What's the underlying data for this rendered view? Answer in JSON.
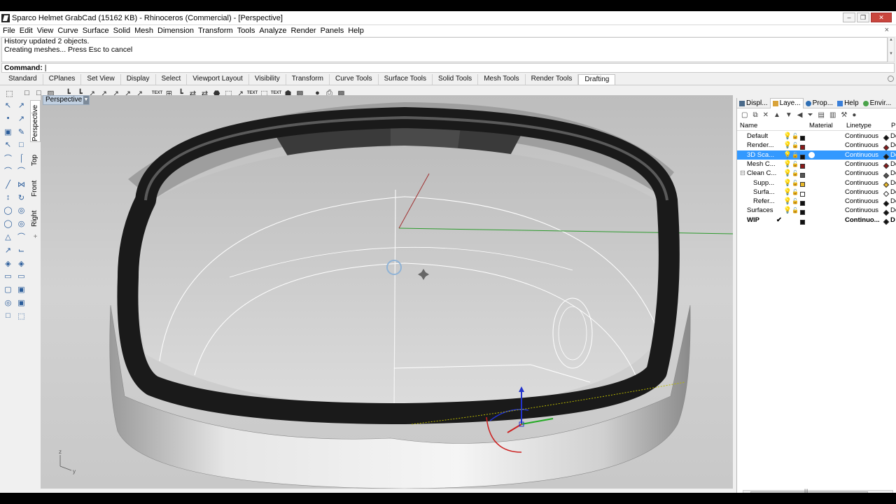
{
  "window": {
    "title": "Sparco Helmet GrabCad (15162 KB) - Rhinoceros (Commercial) - [Perspective]",
    "buttons": [
      "–",
      "❐",
      "✕"
    ]
  },
  "menu": {
    "items": [
      "File",
      "Edit",
      "View",
      "Curve",
      "Surface",
      "Solid",
      "Mesh",
      "Dimension",
      "Transform",
      "Tools",
      "Analyze",
      "Render",
      "Panels",
      "Help"
    ],
    "close": "×"
  },
  "command": {
    "history": [
      "History updated 2 objects.",
      "Creating meshes... Press Esc to cancel"
    ],
    "prompt": "Command:"
  },
  "tabs": {
    "items": [
      "Standard",
      "CPlanes",
      "Set View",
      "Display",
      "Select",
      "Viewport Layout",
      "Visibility",
      "Transform",
      "Curve Tools",
      "Surface Tools",
      "Solid Tools",
      "Mesh Tools",
      "Render Tools",
      "Drafting"
    ],
    "active": "Drafting"
  },
  "toolbar": {
    "icons": [
      "⬚",
      "□",
      "□",
      "▨",
      "┗",
      "┗",
      "↗",
      "↗",
      "↗",
      "↗",
      "↗",
      "TEXT",
      "⊞",
      "┗",
      "⇄",
      "⇄",
      "⬣",
      "⬚",
      "↗",
      "TEXT",
      "⬚",
      "TEXT",
      "⬢",
      "▩",
      "●",
      "⎙",
      "▩"
    ]
  },
  "left_toolbar": {
    "icons": [
      "↖",
      "↗",
      "•",
      "↗",
      "▣",
      "✎",
      "↖",
      "□",
      "⌒",
      "⌠",
      "⌒",
      "⌒",
      "╱",
      "⋈",
      "↕",
      "↻",
      "◯",
      "◎",
      "◯",
      "◎",
      "△",
      "⌒",
      "↗",
      "⌙",
      "◈",
      "◈",
      "▭",
      "▭",
      "▢",
      "▣",
      "◎",
      "▣",
      "□",
      "⬚"
    ]
  },
  "viewport_tabs": [
    "Perspective",
    "Top",
    "Front",
    "Right",
    "+"
  ],
  "viewport": {
    "label": "Perspective",
    "axis_labels": [
      "z",
      "y"
    ]
  },
  "panel": {
    "tabs": [
      "Displ...",
      "Laye...",
      "Prop...",
      "Help",
      "Envir..."
    ],
    "active_tab": "Laye...",
    "columns": [
      "Name",
      "Material",
      "Linetype",
      "P"
    ],
    "layers": [
      {
        "name": "Default",
        "color": "#111111",
        "linetype": "Continuous",
        "print": "De",
        "diamond": "#111111"
      },
      {
        "name": "Render...",
        "color": "#8b1a1a",
        "linetype": "Continuous",
        "print": "De",
        "diamond": "#8b1a1a"
      },
      {
        "name": "3D Sca...",
        "color": "#111111",
        "linetype": "Continuous",
        "print": "De",
        "diamond": "#111111"
      },
      {
        "name": "Mesh C...",
        "color": "#8b1a1a",
        "linetype": "Continuous",
        "print": "De",
        "diamond": "#8b1a1a"
      },
      {
        "name": "Clean C...",
        "color": "#555555",
        "linetype": "Continuous",
        "print": "De",
        "diamond": "#555555"
      },
      {
        "name": "Supp...",
        "color": "#e8b82a",
        "linetype": "Continuous",
        "print": "De",
        "diamond": "#e8b82a"
      },
      {
        "name": "Surfa...",
        "color": "#ffffff",
        "linetype": "Continuous",
        "print": "De",
        "diamond": "#ffffff"
      },
      {
        "name": "Refer...",
        "color": "#111111",
        "linetype": "Continuous",
        "print": "De",
        "diamond": "#111111"
      },
      {
        "name": "Surfaces",
        "color": "#111111",
        "linetype": "Continuous",
        "print": "De",
        "diamond": "#111111"
      },
      {
        "name": "WIP",
        "color": "#111111",
        "linetype": "Continuo...",
        "print": "D",
        "diamond": "#111111"
      }
    ],
    "selected_layer": "3D Sca...",
    "current_layer": "WIP",
    "expander": "⊟",
    "check": "✔",
    "scroll_grip": "|||"
  }
}
